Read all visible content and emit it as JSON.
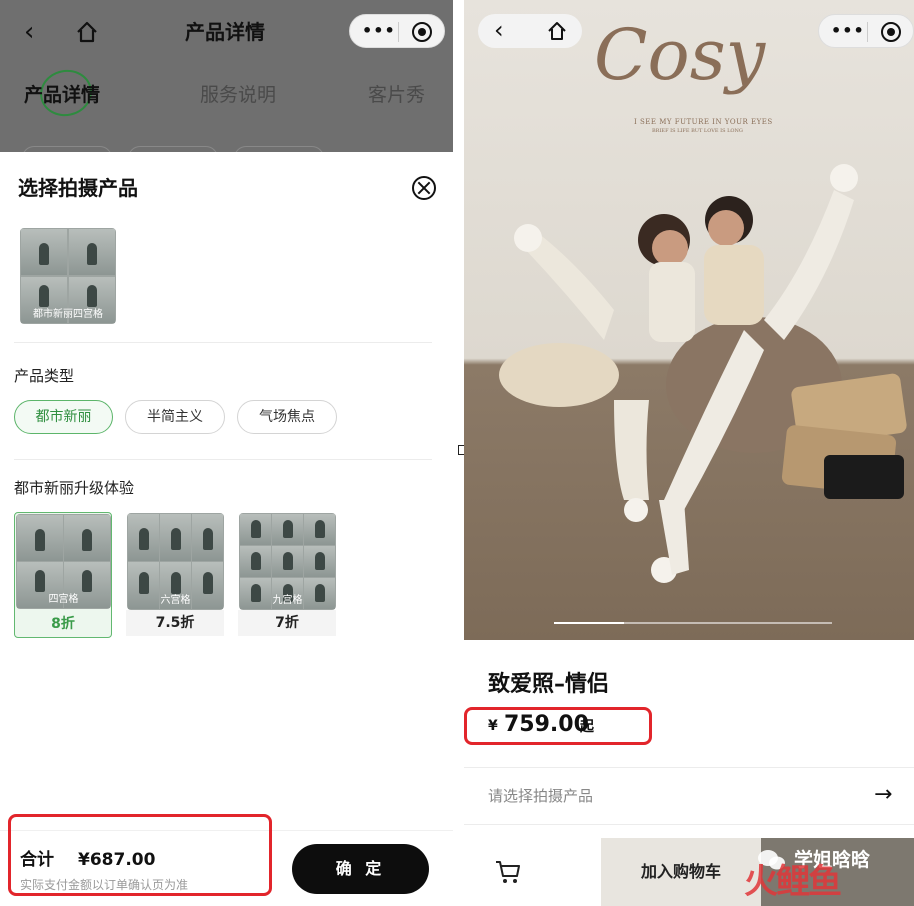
{
  "left": {
    "nav": {
      "back_icon": "chevron-left-icon",
      "home_icon": "home-icon",
      "title": "产品详情"
    },
    "tabs": [
      "产品详情",
      "服务说明",
      "客片秀"
    ],
    "sheet": {
      "title": "选择拍摄产品",
      "close_icon": "close-icon",
      "product_thumb_caption": "都市新丽四宫格",
      "type_label": "产品类型",
      "types": [
        {
          "label": "都市新丽",
          "selected": true
        },
        {
          "label": "半简主义",
          "selected": false
        },
        {
          "label": "气场焦点",
          "selected": false
        }
      ],
      "upgrade_label": "都市新丽升级体验",
      "upgrades": [
        {
          "caption": "四宫格",
          "discount": "8折",
          "selected": true
        },
        {
          "caption": "六宫格",
          "discount": "7.5折",
          "selected": false
        },
        {
          "caption": "九宫格",
          "discount": "7折",
          "selected": false
        }
      ]
    },
    "footer": {
      "total_label": "合计",
      "total_amount": "¥687.00",
      "note": "实际支付金额以订单确认页为准",
      "confirm": "确 定"
    }
  },
  "right": {
    "hero": {
      "logo_text": "Cosy",
      "tagline": "I SEE MY FUTURE IN YOUR EYES",
      "tagline_small": "BRIEF IS LIFE BUT LOVE IS LONG",
      "carousel_progress": 0.25
    },
    "product": {
      "title": "致爱照–情侣",
      "currency": "¥",
      "price": "759.00",
      "price_suffix": "起"
    },
    "select_prompt": "请选择拍摄产品",
    "bottom_bar": {
      "cart_icon": "cart-icon",
      "add_to_cart": "加入购物车",
      "watermark": "学姐晗晗"
    }
  },
  "colors": {
    "accent_green": "#5cb56a",
    "highlight_red": "#e2252b",
    "dark_button": "#0d0d0d"
  }
}
